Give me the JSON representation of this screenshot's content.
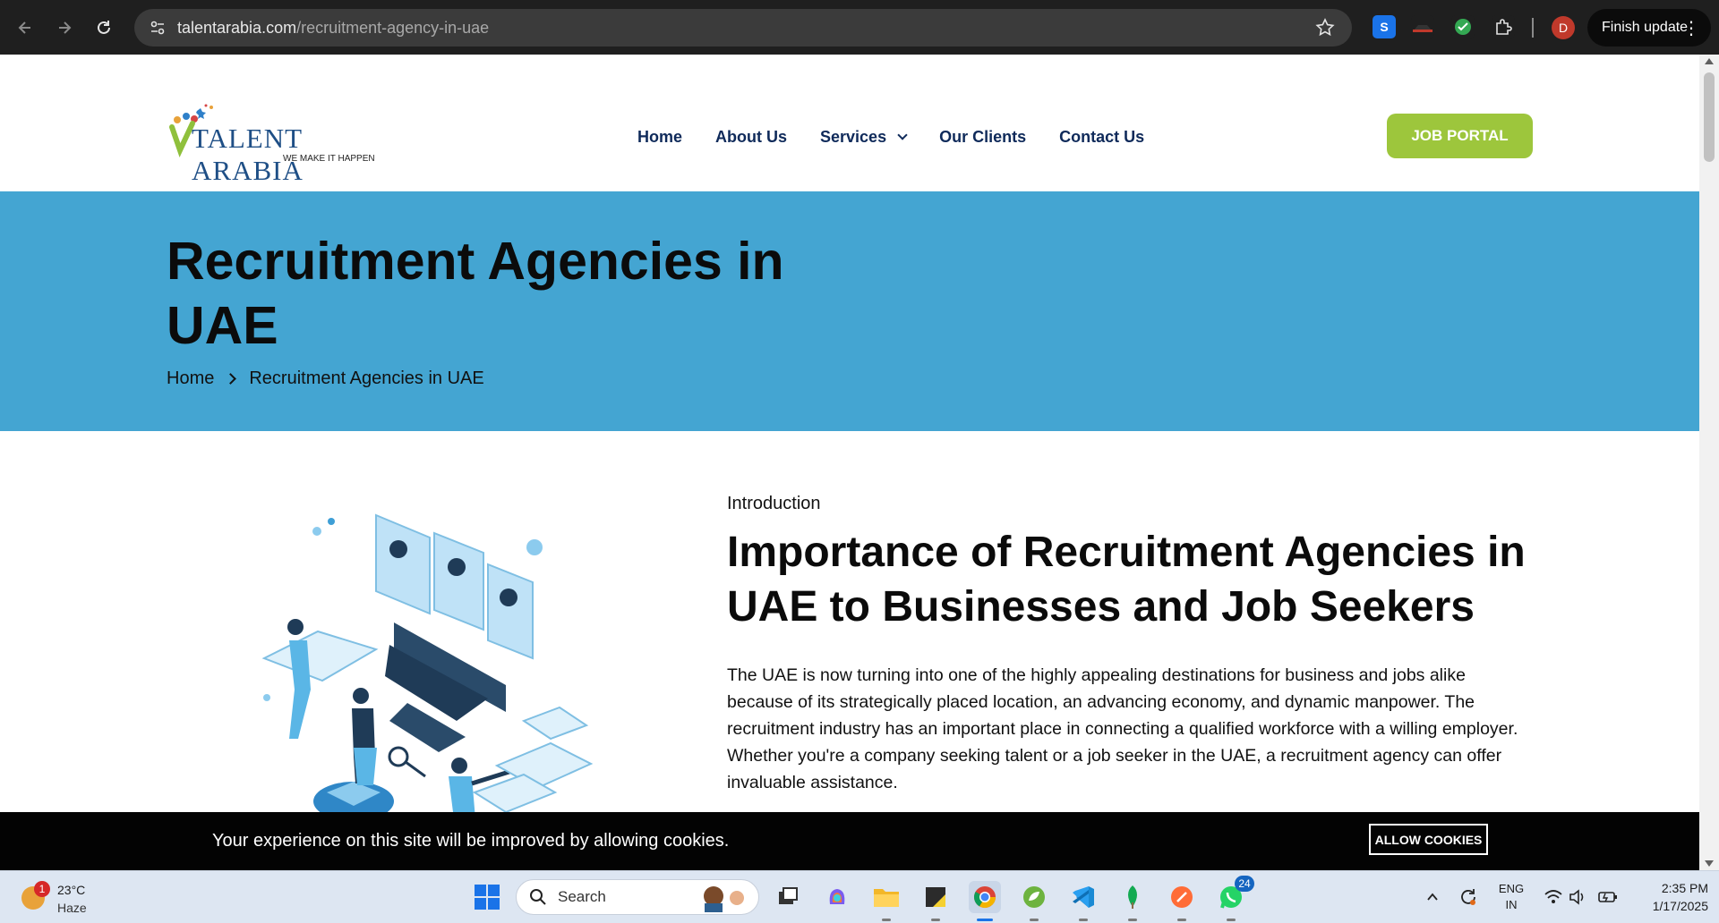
{
  "browser": {
    "url_host": "talentarabia.com",
    "url_path": "/recruitment-agency-in-uae",
    "profile_initial": "D",
    "finish_update_label": "Finish update"
  },
  "site": {
    "logo": {
      "brand": "TALENT ARABIA",
      "tagline": "WE MAKE IT HAPPEN"
    },
    "nav": [
      "Home",
      "About Us",
      "Services",
      "Our Clients",
      "Contact Us"
    ],
    "job_portal_label": "JOB PORTAL"
  },
  "hero": {
    "title": "Recruitment Agencies in UAE",
    "breadcrumb": [
      "Home",
      "Recruitment Agencies in UAE"
    ]
  },
  "intro": {
    "label": "Introduction",
    "title": "Importance of Recruitment Agencies in UAE to Businesses and Job Seekers",
    "body": "The UAE is now turning into one of the highly appealing destinations for business and jobs alike because of its strategically placed location, an advancing economy, and dynamic manpower. The recruitment industry has an important place in connecting a qualified workforce with a willing employer. Whether you're a company seeking talent or a job seeker in the UAE, a recruitment agency can offer invaluable assistance."
  },
  "cookie": {
    "message": "Your experience on this site will be improved by allowing cookies.",
    "button": "ALLOW COOKIES"
  },
  "taskbar": {
    "weather": {
      "temp": "23°C",
      "condition": "Haze",
      "badge": "1"
    },
    "search_label": "Search",
    "whatsapp_badge": "24",
    "language": [
      "ENG",
      "IN"
    ],
    "time": "2:35 PM",
    "date": "1/17/2025"
  },
  "colors": {
    "hero_bg": "#44a5d2",
    "job_portal": "#9dc63c",
    "nav_text": "#0f2a5a"
  }
}
